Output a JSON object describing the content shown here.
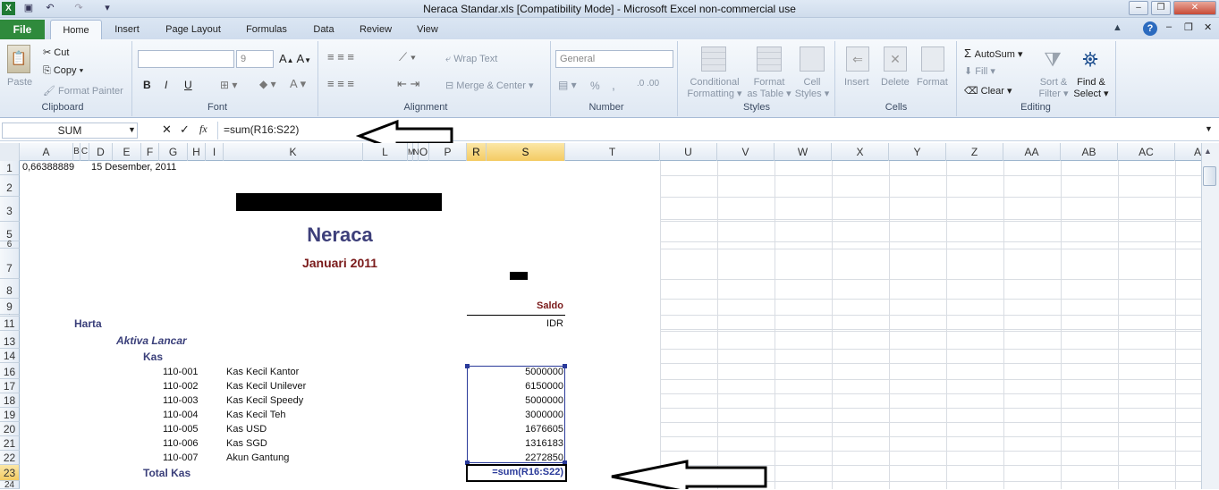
{
  "window": {
    "title": "Neraca Standar.xls  [Compatibility Mode]  -  Microsoft Excel non-commercial use",
    "controls": [
      "–",
      "❐",
      "✕"
    ]
  },
  "tabs": [
    "File",
    "Home",
    "Insert",
    "Page Layout",
    "Formulas",
    "Data",
    "Review",
    "View"
  ],
  "ribbon": {
    "clipboard": {
      "paste": "Paste",
      "cut": "Cut",
      "copy": "Copy",
      "format_painter": "Format Painter",
      "label": "Clipboard"
    },
    "font": {
      "font_name": "",
      "font_size": "9",
      "bold": "B",
      "italic": "I",
      "underline": "U",
      "label": "Font"
    },
    "alignment": {
      "wrap_text": "Wrap Text",
      "merge_center": "Merge & Center",
      "label": "Alignment"
    },
    "number": {
      "format": "General",
      "percent": "%",
      "comma": ",",
      "label": "Number"
    },
    "styles": {
      "conditional": "Conditional",
      "conditional2": "Formatting",
      "format_as": "Format",
      "format_as2": "as Table",
      "cell": "Cell",
      "cell2": "Styles",
      "label": "Styles"
    },
    "cells": {
      "insert": "Insert",
      "delete": "Delete",
      "format": "Format",
      "label": "Cells"
    },
    "editing": {
      "autosum": "AutoSum",
      "fill": "Fill",
      "clear": "Clear",
      "sort": "Sort &",
      "sort2": "Filter",
      "find": "Find &",
      "find2": "Select",
      "label": "Editing"
    }
  },
  "formula_bar": {
    "name_box": "SUM",
    "formula": "=sum(R16:S22)",
    "fx": "fx"
  },
  "columns": [
    "A",
    "B",
    "C",
    "D",
    "E",
    "F",
    "G",
    "H",
    "I",
    "K",
    "L",
    "M",
    "N",
    "O",
    "P",
    "R",
    "S",
    "T",
    "U",
    "V",
    "W",
    "X",
    "Y",
    "Z",
    "AA",
    "AB",
    "AC",
    "A"
  ],
  "rows": [
    "1",
    "2",
    "3",
    "5",
    "6",
    "7",
    "8",
    "9",
    "10",
    "11",
    "13",
    "14",
    "16",
    "17",
    "18",
    "19",
    "20",
    "21",
    "22",
    "23",
    "24"
  ],
  "sheet": {
    "a1": "0,66388889",
    "date": "15 Desember, 2011",
    "title": "Neraca",
    "period": "Januari 2011",
    "saldo": "Saldo",
    "currency": "IDR",
    "harta": "Harta",
    "aktiva_lancar": "Aktiva Lancar",
    "kas": "Kas",
    "accounts": [
      {
        "code": "110-001",
        "name": "Kas Kecil Kantor",
        "value": "5000000"
      },
      {
        "code": "110-002",
        "name": "Kas Kecil Unilever",
        "value": "6150000"
      },
      {
        "code": "110-003",
        "name": "Kas Kecil Speedy",
        "value": "5000000"
      },
      {
        "code": "110-004",
        "name": "Kas Kecil Teh",
        "value": "3000000"
      },
      {
        "code": "110-005",
        "name": "Kas USD",
        "value": "1676605"
      },
      {
        "code": "110-006",
        "name": "Kas SGD",
        "value": "1316183"
      },
      {
        "code": "110-007",
        "name": "Akun Gantung",
        "value": "2272850"
      }
    ],
    "total_kas": "Total Kas",
    "active_formula": "=sum(R16:S22)"
  },
  "colors": {
    "file_tab": "#2f8a3c",
    "title_text": "#3d3f7a",
    "period_text": "#7a1a1a",
    "selection": "#f4cb63",
    "range_border": "#2a3a9a"
  }
}
